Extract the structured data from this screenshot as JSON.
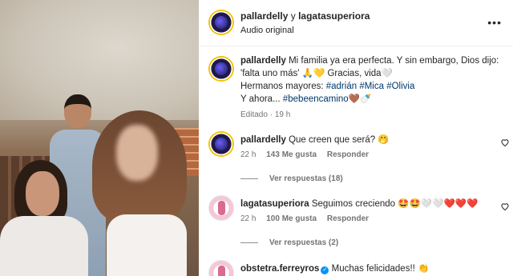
{
  "header": {
    "user1": "pallardelly",
    "conj": "y",
    "user2": "lagatasuperiora",
    "audio": "Audio original",
    "more_icon": "more-horizontal-icon"
  },
  "caption": {
    "username": "pallardelly",
    "line1": "Mi familia ya era perfecta. Y sin embargo, Dios dijo:",
    "line2": "'falta uno más' 🙏💛 Gracias, vida🤍",
    "line3_prefix": "Hermanos mayores:",
    "tags": [
      "#adrián",
      "#Mica",
      "#Olivia"
    ],
    "line4_prefix": "Y ahora...",
    "tag_final": "#bebeencamino",
    "line4_suffix": "🤎🍼",
    "edited": "Editado",
    "time": "19 h"
  },
  "comments": [
    {
      "username": "pallardelly",
      "text": "Que creen que será? 🤭",
      "time": "22 h",
      "likes": "143 Me gusta",
      "reply": "Responder",
      "view_replies": "Ver respuestas (18)"
    },
    {
      "username": "lagatasuperiora",
      "text": "Seguimos creciendo 🤩🤩🤍🤍❤️❤️❤️",
      "time": "22 h",
      "likes": "100 Me gusta",
      "reply": "Responder",
      "view_replies": "Ver respuestas (2)"
    },
    {
      "username": "obstetra.ferreyros",
      "text": "Muchas felicidades!! 👏",
      "verified": true
    }
  ],
  "colors": {
    "link": "#00376b",
    "meta": "#737373",
    "verified": "#0095f6"
  }
}
